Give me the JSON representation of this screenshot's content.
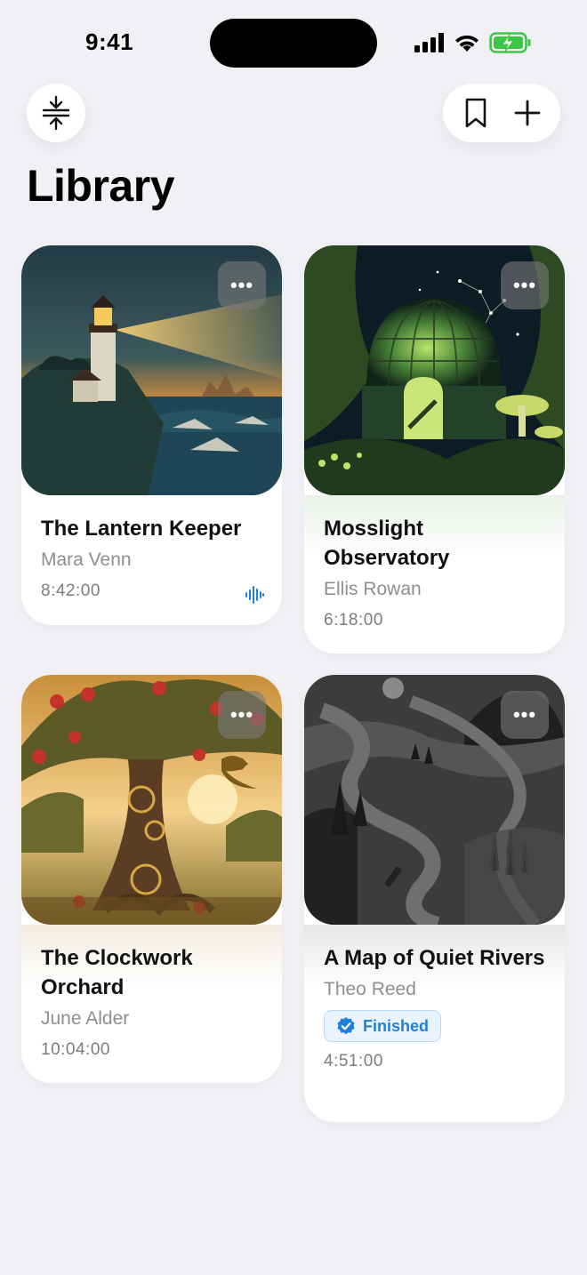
{
  "status_bar": {
    "time": "9:41"
  },
  "header": {
    "title": "Library"
  },
  "colors": {
    "accent": "#1e80d8",
    "background": "#f1f0f5",
    "battery": "#3dc546"
  },
  "books": [
    {
      "title": "The Lantern Keeper",
      "author": "Mara Venn",
      "duration": "8:42:00",
      "playing": true
    },
    {
      "title": "Mosslight Observatory",
      "author": "Ellis Rowan",
      "duration": "6:18:00"
    },
    {
      "title": "The Clockwork Orchard",
      "author": "June Alder",
      "duration": "10:04:00"
    },
    {
      "title": "A Map of Quiet Rivers",
      "author": "Theo Reed",
      "duration": "4:51:00",
      "badge": "Finished"
    }
  ],
  "icons": {
    "collapse": "collapse-vertical-icon",
    "bookmark": "bookmark-icon",
    "add": "plus-icon",
    "more": "ellipsis-icon",
    "playing": "waveform-icon",
    "finished": "checkmark-seal-icon"
  },
  "more_label": "•••"
}
